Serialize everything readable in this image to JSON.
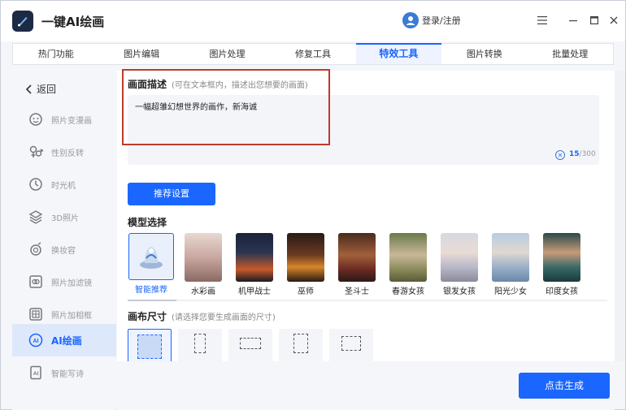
{
  "app": {
    "title": "一键AI绘画"
  },
  "user": {
    "login_label": "登录/注册"
  },
  "tabs": [
    {
      "label": "热门功能"
    },
    {
      "label": "图片编辑"
    },
    {
      "label": "图片处理"
    },
    {
      "label": "修复工具"
    },
    {
      "label": "特效工具",
      "active": true
    },
    {
      "label": "图片转换"
    },
    {
      "label": "批量处理"
    }
  ],
  "sidebar": {
    "back_label": "返回",
    "items": [
      {
        "label": "照片变漫画",
        "icon": "cartoon-face-icon"
      },
      {
        "label": "性别反转",
        "icon": "gender-icon"
      },
      {
        "label": "时光机",
        "icon": "clock-icon"
      },
      {
        "label": "3D照片",
        "icon": "layers-icon"
      },
      {
        "label": "换妆容",
        "icon": "makeup-icon"
      },
      {
        "label": "照片加滤镜",
        "icon": "filter-icon"
      },
      {
        "label": "照片加相框",
        "icon": "frame-icon"
      },
      {
        "label": "AI绘画",
        "icon": "ai-icon",
        "active": true
      },
      {
        "label": "智能写诗",
        "icon": "ai-doc-icon"
      }
    ]
  },
  "description": {
    "title": "画面描述",
    "hint": "(可在文本框内，描述出您想要的画面)",
    "value": "一幅超雏幻想世界的画作，新海诚",
    "count": "15",
    "max": "/300"
  },
  "recommend_label": "推荐设置",
  "model": {
    "title": "模型选择",
    "items": [
      {
        "name": "智能推荐",
        "color": "#e9f0fb"
      },
      {
        "name": "水彩画",
        "color": "#c9a7a0"
      },
      {
        "name": "机甲战士",
        "color": "#2a3550"
      },
      {
        "name": "巫师",
        "color": "#4a2a1e"
      },
      {
        "name": "圣斗士",
        "color": "#5a3a2a"
      },
      {
        "name": "春游女孩",
        "color": "#8a8a5a"
      },
      {
        "name": "银发女孩",
        "color": "#b8b8c8"
      },
      {
        "name": "阳光少女",
        "color": "#9ab0c8"
      },
      {
        "name": "印度女孩",
        "color": "#3a6a6a"
      }
    ]
  },
  "canvas": {
    "title": "画布尺寸",
    "hint": "(请选择您要生成画面的尺寸)"
  },
  "generate_label": "点击生成"
}
